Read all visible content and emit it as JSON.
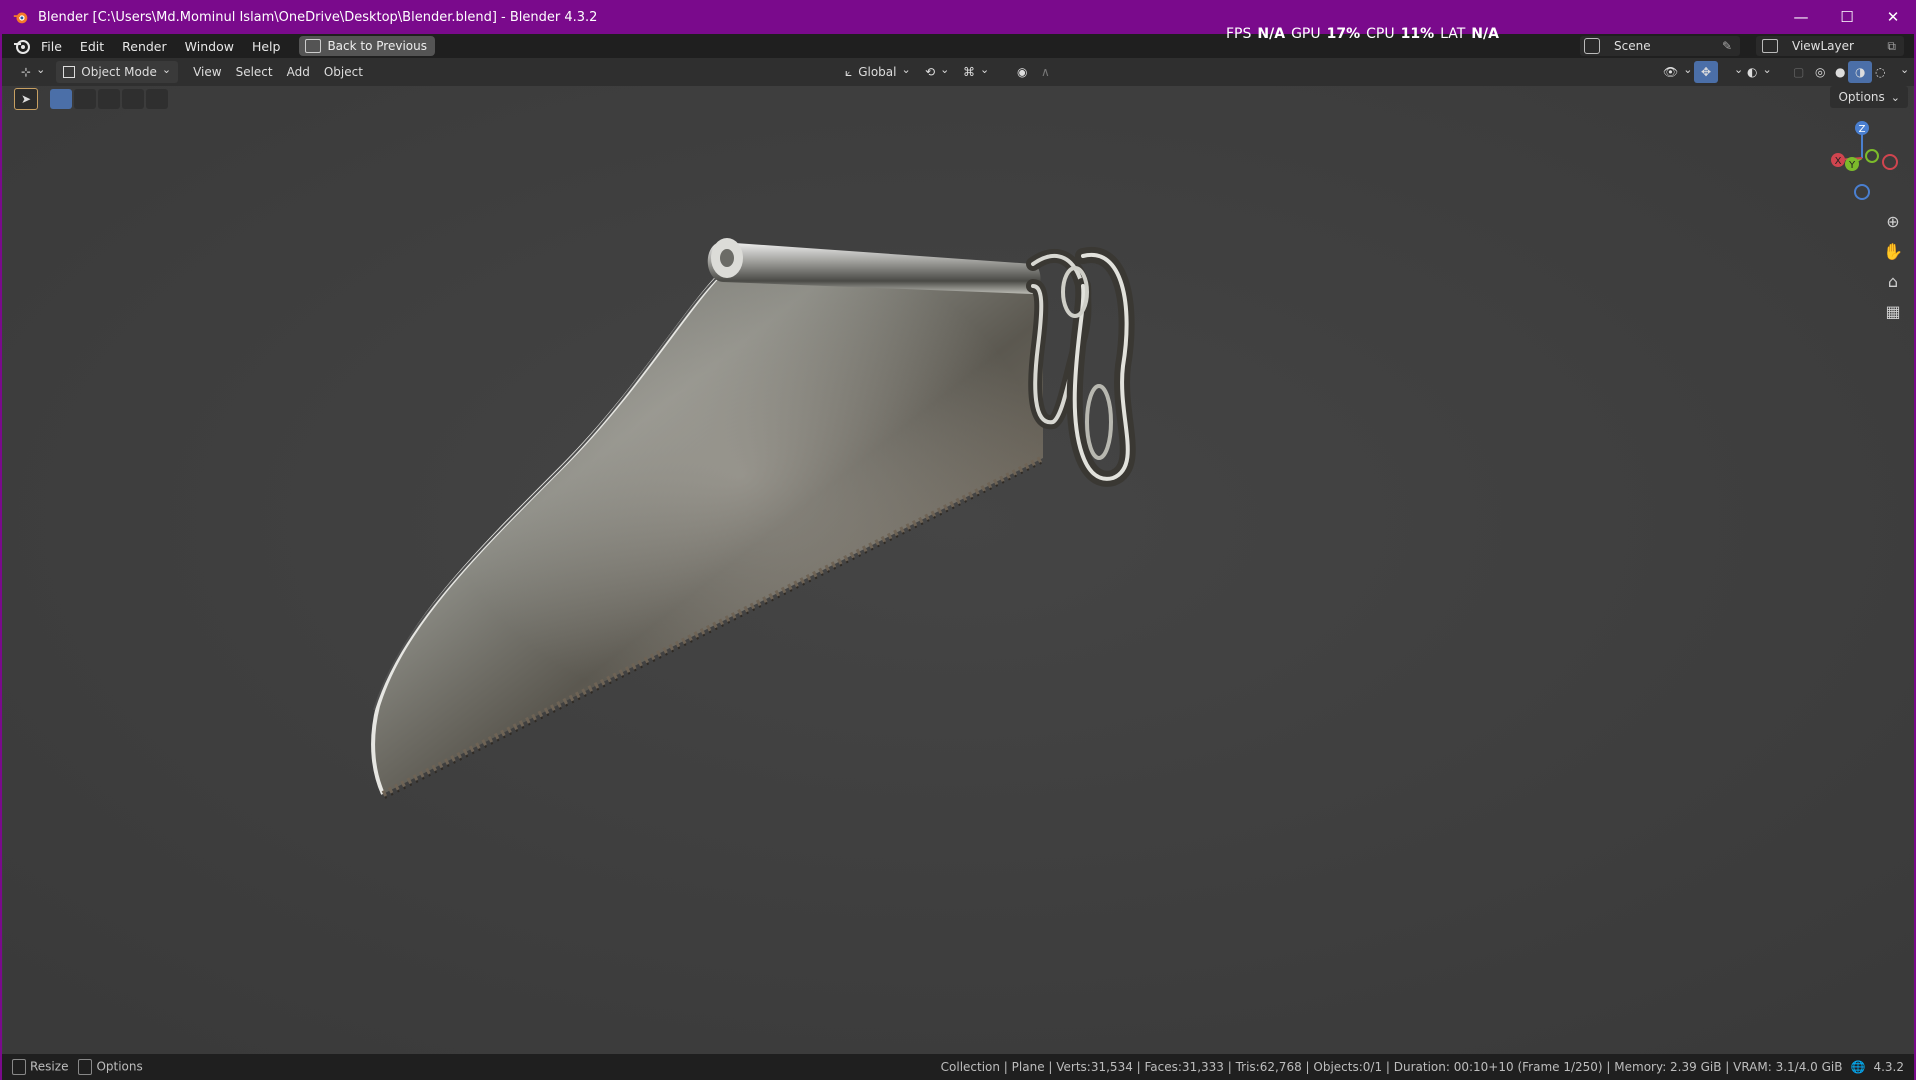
{
  "window": {
    "title": "Blender [C:\\Users\\Md.Mominul Islam\\OneDrive\\Desktop\\Blender.blend] - Blender 4.3.2",
    "minimize": "—",
    "maximize": "☐",
    "close": "✕",
    "accent": "#7a0a8c"
  },
  "perf": {
    "fps_label": "FPS",
    "fps_value": "N/A",
    "gpu_label": "GPU",
    "gpu_value": "17%",
    "cpu_label": "CPU",
    "cpu_value": "11%",
    "lat_label": "LAT",
    "lat_value": "N/A"
  },
  "menubar": {
    "items": [
      "File",
      "Edit",
      "Render",
      "Window",
      "Help"
    ],
    "back_button": "Back to Previous",
    "scene_name": "Scene",
    "view_layer": "ViewLayer"
  },
  "header": {
    "mode": "Object Mode",
    "menus": [
      "View",
      "Select",
      "Add",
      "Object"
    ],
    "transform_orientation": "Global",
    "options": "Options"
  },
  "gizmo": {
    "z": "Z",
    "y": "Y",
    "x": "X"
  },
  "status": {
    "left_resize": "Resize",
    "left_options": "Options",
    "info": "Collection | Plane | Verts:31,534 | Faces:31,333 | Tris:62,768 | Objects:0/1 | Duration: 00:10+10 (Frame 1/250) | Memory: 2.39 GiB | VRAM: 3.1/4.0 GiB",
    "version": "4.3.2"
  }
}
